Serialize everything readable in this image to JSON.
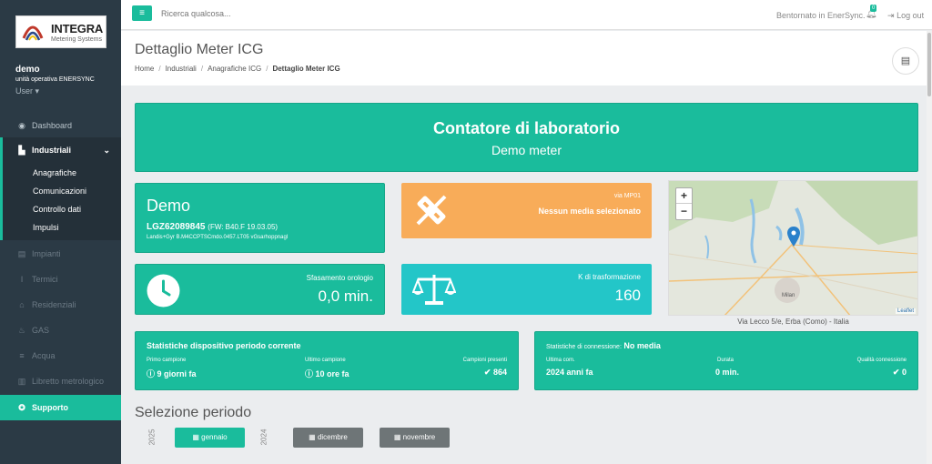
{
  "brand": {
    "name": "INTEGRA",
    "subtitle": "Metering Systems"
  },
  "user": {
    "name": "demo",
    "unit": "unità operativa ENERSYNC",
    "role": "User ▾"
  },
  "sidebar": {
    "items": [
      {
        "label": "Dashboard",
        "icon": "dashboard-icon"
      },
      {
        "label": "Industriali",
        "icon": "building-icon"
      },
      {
        "label": "Impianti",
        "icon": "plant-icon"
      },
      {
        "label": "Termici",
        "icon": "thermometer-icon"
      },
      {
        "label": "Residenziali",
        "icon": "home-icon"
      },
      {
        "label": "GAS",
        "icon": "fire-icon"
      },
      {
        "label": "Acqua",
        "icon": "water-icon"
      },
      {
        "label": "Libretto metrologico",
        "icon": "book-icon"
      },
      {
        "label": "Supporto",
        "icon": "support-icon"
      }
    ],
    "submenu": [
      "Anagrafiche",
      "Comunicazioni",
      "Controllo dati",
      "Impulsi"
    ]
  },
  "topbar": {
    "search_placeholder": "Ricerca qualcosa...",
    "welcome": "Bentornato in EnerSync.",
    "notifications": "0",
    "logout": "Log out"
  },
  "page": {
    "title": "Dettaglio Meter ICG",
    "breadcrumb": [
      "Home",
      "Industriali",
      "Anagrafiche ICG",
      "Dettaglio Meter ICG"
    ]
  },
  "hero": {
    "title": "Contatore di laboratorio",
    "subtitle": "Demo meter"
  },
  "device": {
    "name": "Demo",
    "serial": "LGZ62089845",
    "firmware": "(FW: B40.F 19.03.05)",
    "desc": "Landis+Gyr B.M4CCPTSCmdo.0457.LT05 vGsarhoppnagl"
  },
  "media": {
    "via": "via MP01",
    "status": "Nessun media selezionato"
  },
  "clock": {
    "label": "Sfasamento orologio",
    "value": "0,0 min."
  },
  "transform": {
    "label": "K di trasformazione",
    "value": "160"
  },
  "map": {
    "caption": "Via Lecco 5/e, Erba (Como) - Italia",
    "attribution": "Leaflet",
    "zoom_in": "+",
    "zoom_out": "−",
    "city": "Milan"
  },
  "stats_device": {
    "title": "Statistiche dispositivo periodo corrente",
    "first_label": "Primo campione",
    "first_value": "9 giorni fa",
    "last_label": "Ultimo campione",
    "last_value": "10 ore fa",
    "count_label": "Campioni presenti",
    "count_value": "864"
  },
  "stats_conn": {
    "title_prefix": "Statistiche di connessione:",
    "title_value": "No media",
    "last_label": "Ultima com.",
    "last_value": "2024 anni fa",
    "duration_label": "Durata",
    "duration_value": "0 min.",
    "quality_label": "Qualità connessione",
    "quality_value": "0"
  },
  "period": {
    "title": "Selezione periodo",
    "years": [
      "2025",
      "2024"
    ],
    "buttons": [
      "gennaio",
      "dicembre",
      "novembre"
    ]
  },
  "colors": {
    "accent": "#1abc9c",
    "orange": "#f8ac59",
    "cyan": "#23c6c8",
    "sidebar": "#2b3a45"
  }
}
